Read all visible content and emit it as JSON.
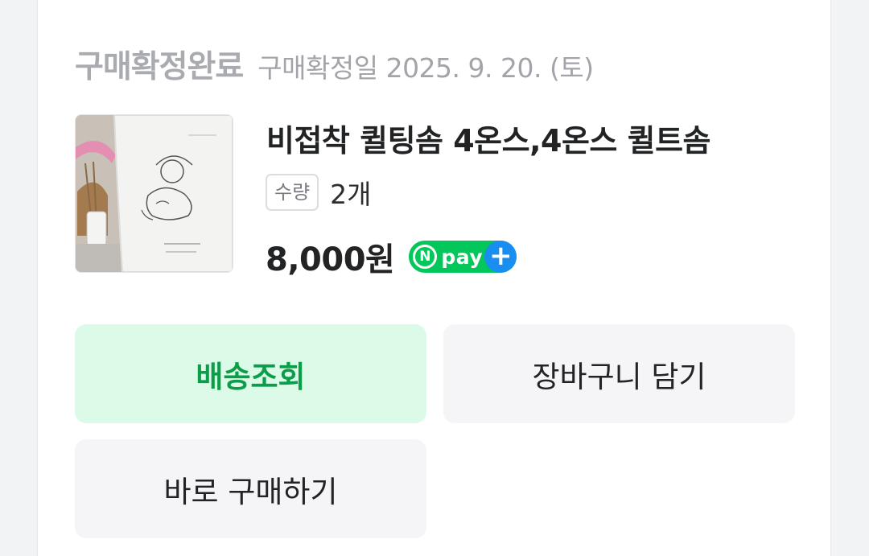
{
  "order": {
    "status_title": "구매확정완료",
    "confirm_date": "구매확정일 2025. 9. 20. (토)"
  },
  "product": {
    "name": "비접착 퀼팅솜 4온스,4온스 퀼트솜",
    "quantity_label": "수량",
    "quantity_value": "2개",
    "price": "8,000원",
    "thumbnail_icon": "product-photo-icon"
  },
  "npay": {
    "n": "N",
    "text": "pay",
    "plus": "+"
  },
  "buttons": {
    "track_delivery": "배송조회",
    "add_to_cart": "장바구니 담기",
    "buy_now": "바로 구매하기"
  },
  "colors": {
    "accent_green": "#03c75a",
    "track_button_bg": "#dcfae8",
    "track_button_text": "#0c9d4a",
    "npay_plus_blue": "#1a8ef0"
  }
}
